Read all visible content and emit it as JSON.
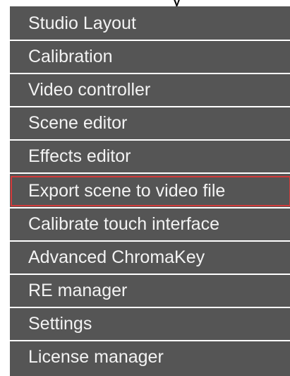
{
  "menu": {
    "cropped_header_fragment": "y",
    "highlight_color": "#d23a3a",
    "background_color": "#555555",
    "text_color": "#f3f3f3",
    "items": [
      {
        "label": "Studio Layout"
      },
      {
        "label": "Calibration"
      },
      {
        "label": "Video controller"
      },
      {
        "label": "Scene editor"
      },
      {
        "label": "Effects editor"
      },
      {
        "label": "Export scene to video file",
        "highlighted": true
      },
      {
        "label": "Calibrate touch interface"
      },
      {
        "label": "Advanced ChromaKey"
      },
      {
        "label": "RE manager"
      },
      {
        "label": "Settings"
      },
      {
        "label": "License manager"
      }
    ]
  }
}
